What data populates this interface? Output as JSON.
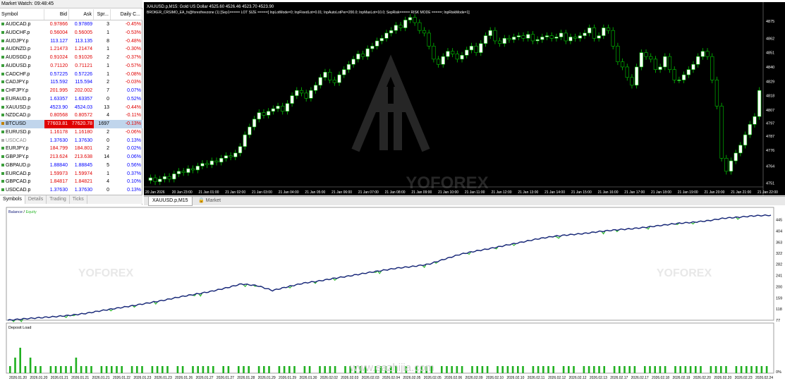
{
  "market_watch": {
    "title": "Market Watch: 09:48:45",
    "columns": [
      "Symbol",
      "Bid",
      "Ask",
      "Spr...",
      "Daily C..."
    ],
    "rows": [
      {
        "symbol": "AUDCAD.p",
        "bid": "0.97866",
        "ask": "0.97869",
        "spread": "3",
        "change": "-0.45%",
        "color": "#e00000",
        "bidcolor": "#e00000",
        "askcolor": "#0000ff"
      },
      {
        "symbol": "AUDCHF.p",
        "bid": "0.56004",
        "ask": "0.56005",
        "spread": "1",
        "change": "-0.53%",
        "color": "#e00000",
        "bidcolor": "#e00000",
        "askcolor": "#e00000"
      },
      {
        "symbol": "AUDJPY.p",
        "bid": "113.127",
        "ask": "113.135",
        "spread": "8",
        "change": "-0.48%",
        "color": "#e00000",
        "bidcolor": "#0000ff",
        "askcolor": "#0000ff"
      },
      {
        "symbol": "AUDNZD.p",
        "bid": "1.21473",
        "ask": "1.21474",
        "spread": "1",
        "change": "-0.30%",
        "color": "#e00000",
        "bidcolor": "#e00000",
        "askcolor": "#e00000"
      },
      {
        "symbol": "AUDSGD.p",
        "bid": "0.91024",
        "ask": "0.91026",
        "spread": "2",
        "change": "-0.37%",
        "color": "#e00000",
        "bidcolor": "#e00000",
        "askcolor": "#e00000"
      },
      {
        "symbol": "AUDUSD.p",
        "bid": "0.71120",
        "ask": "0.71121",
        "spread": "1",
        "change": "-0.57%",
        "color": "#e00000",
        "bidcolor": "#e00000",
        "askcolor": "#e00000"
      },
      {
        "symbol": "CADCHF.p",
        "bid": "0.57225",
        "ask": "0.57226",
        "spread": "1",
        "change": "-0.08%",
        "color": "#e00000",
        "bidcolor": "#0000ff",
        "askcolor": "#0000ff"
      },
      {
        "symbol": "CADJPY.p",
        "bid": "115.592",
        "ask": "115.594",
        "spread": "2",
        "change": "-0.03%",
        "color": "#e00000",
        "bidcolor": "#0000ff",
        "askcolor": "#0000ff"
      },
      {
        "symbol": "CHFJPY.p",
        "bid": "201.995",
        "ask": "202.002",
        "spread": "7",
        "change": "0.07%",
        "color": "#0000ff",
        "bidcolor": "#e00000",
        "askcolor": "#e00000"
      },
      {
        "symbol": "EURAUD.p",
        "bid": "1.63357",
        "ask": "1.63357",
        "spread": "0",
        "change": "0.52%",
        "color": "#0000ff",
        "bidcolor": "#0000ff",
        "askcolor": "#0000ff"
      },
      {
        "symbol": "XAUUSD.p",
        "bid": "4523.90",
        "ask": "4524.03",
        "spread": "13",
        "change": "-0.44%",
        "color": "#e00000",
        "bidcolor": "#0000ff",
        "askcolor": "#0000ff"
      },
      {
        "symbol": "NZDCAD.p",
        "bid": "0.80568",
        "ask": "0.80572",
        "spread": "4",
        "change": "-0.11%",
        "color": "#e00000",
        "bidcolor": "#e00000",
        "askcolor": "#e00000"
      },
      {
        "symbol": "BTCUSD",
        "bid": "77603.81",
        "ask": "77620.78",
        "spread": "1697",
        "change": "-0.13%",
        "color": "#e00000",
        "bidcolor": "#e00000",
        "askcolor": "#e00000",
        "selected": true
      },
      {
        "symbol": "EURUSD.p",
        "bid": "1.16178",
        "ask": "1.16180",
        "spread": "2",
        "change": "-0.06%",
        "color": "#e00000",
        "bidcolor": "#e00000",
        "askcolor": "#e00000"
      },
      {
        "symbol": "USDCAD",
        "bid": "1.37630",
        "ask": "1.37630",
        "spread": "0",
        "change": "0.13%",
        "color": "#0000ff",
        "bidcolor": "#0000ff",
        "askcolor": "#0000ff",
        "grey": true
      },
      {
        "symbol": "EURJPY.p",
        "bid": "184.799",
        "ask": "184.801",
        "spread": "2",
        "change": "0.02%",
        "color": "#0000ff",
        "bidcolor": "#e00000",
        "askcolor": "#e00000"
      },
      {
        "symbol": "GBPJPY.p",
        "bid": "213.624",
        "ask": "213.638",
        "spread": "14",
        "change": "0.06%",
        "color": "#0000ff",
        "bidcolor": "#e00000",
        "askcolor": "#e00000"
      },
      {
        "symbol": "GBPAUD.p",
        "bid": "1.88840",
        "ask": "1.88845",
        "spread": "5",
        "change": "0.56%",
        "color": "#0000ff",
        "bidcolor": "#0000ff",
        "askcolor": "#0000ff"
      },
      {
        "symbol": "EURCAD.p",
        "bid": "1.59973",
        "ask": "1.59974",
        "spread": "1",
        "change": "0.37%",
        "color": "#0000ff",
        "bidcolor": "#e00000",
        "askcolor": "#e00000"
      },
      {
        "symbol": "GBPCAD.p",
        "bid": "1.84817",
        "ask": "1.84821",
        "spread": "4",
        "change": "0.10%",
        "color": "#0000ff",
        "bidcolor": "#e00000",
        "askcolor": "#e00000"
      },
      {
        "symbol": "USDCAD.p",
        "bid": "1.37630",
        "ask": "1.37630",
        "spread": "0",
        "change": "0.13%",
        "color": "#0000ff",
        "bidcolor": "#0000ff",
        "askcolor": "#0000ff"
      }
    ],
    "tabs": [
      "Symbols",
      "Details",
      "Trading",
      "Ticks"
    ]
  },
  "price_chart": {
    "header": "XAUUSD.p,M15:  Gold US Dollar  4525.60 4526.46 4523.70 4523.90",
    "ea_line": "BROKER_CRSIMO_EA_fx@forexfreezone (1) [Sep1===== LOT SIZE =====] InpLotMode=0; InpFixedLot=0.01; InpAutoLotPer=200.0; InpMaxLot=10.0; SepRisk===== RISK MODE =====; InpRiskMode=1]",
    "y_labels": [
      "4875",
      "4862",
      "4851",
      "4840",
      "4829",
      "4818",
      "4807",
      "4797",
      "4787",
      "4776",
      "4764",
      "4751"
    ],
    "x_labels": [
      "20 Jan 2026",
      "20 Jan 23:00",
      "21 Jan 01:00",
      "21 Jan 02:00",
      "21 Jan 03:00",
      "21 Jan 04:00",
      "21 Jan 05:00",
      "21 Jan 06:00",
      "21 Jan 07:00",
      "21 Jan 08:00",
      "21 Jan 09:00",
      "21 Jan 10:00",
      "21 Jan 11:00",
      "21 Jan 12:00",
      "21 Jan 13:00",
      "21 Jan 14:00",
      "21 Jan 15:00",
      "21 Jan 16:00",
      "21 Jan 17:00",
      "21 Jan 18:00",
      "21 Jan 19:00",
      "21 Jan 20:00",
      "21 Jan 21:00",
      "21 Jan 22:00"
    ],
    "closes": [
      4755,
      4752,
      4754,
      4756,
      4754,
      4758,
      4760,
      4759,
      4762,
      4761,
      4764,
      4766,
      4765,
      4768,
      4767,
      4770,
      4772,
      4771,
      4774,
      4779,
      4788,
      4794,
      4800,
      4805,
      4803,
      4806,
      4808,
      4810,
      4806,
      4812,
      4818,
      4822,
      4820,
      4816,
      4822,
      4826,
      4832,
      4836,
      4830,
      4828,
      4834,
      4838,
      4842,
      4846,
      4850,
      4848,
      4854,
      4856,
      4860,
      4862,
      4866,
      4868,
      4872,
      4870,
      4876,
      4878,
      4874,
      4868,
      4866,
      4856,
      4846,
      4842,
      4848,
      4852,
      4850,
      4846,
      4849,
      4853,
      4856,
      4851,
      4858,
      4864,
      4868,
      4860,
      4858,
      4862,
      4861,
      4863,
      4864,
      4862,
      4865,
      4860,
      4861,
      4863,
      4864,
      4862,
      4863,
      4866,
      4860,
      4863,
      4862,
      4864,
      4866,
      4870,
      4862,
      4864,
      4870,
      4868,
      4856,
      4844,
      4840,
      4832,
      4826,
      4840,
      4851,
      4848,
      4846,
      4838,
      4840,
      4848,
      4838,
      4830,
      4830,
      4834,
      4838,
      4842,
      4848,
      4852,
      4848,
      4830,
      4810,
      4770,
      4760,
      4768,
      4774,
      4780,
      4788,
      4796,
      4802,
      4822
    ],
    "colors": {
      "bg": "#000000",
      "candle": "#ffffff",
      "bear": "#000000",
      "wick": "#00c800",
      "grid": "#3a3a3a",
      "text": "#ffffff"
    },
    "watermark": "YOFOREX",
    "tabs": [
      "XAUUSD.p,M15",
      "Market"
    ]
  },
  "chart_data": [
    {
      "type": "line",
      "title": "",
      "series": [
        {
          "name": "Balance",
          "color": "#1a237e"
        },
        {
          "name": "Equity",
          "color": "#2eb82e"
        }
      ],
      "x": [
        "2026.01.20",
        "2026.01.20",
        "2026.01.21",
        "2026.01.21",
        "2026.01.21",
        "2026.01.22",
        "2026.01.23",
        "2026.01.23",
        "2026.01.26",
        "2026.01.27",
        "2026.01.27",
        "2026.01.28",
        "2026.01.29",
        "2026.01.29",
        "2026.01.30",
        "2026.02.02",
        "2026.02.03",
        "2026.02.03",
        "2026.02.04",
        "2026.02.05",
        "2026.02.05",
        "2026.02.06",
        "2026.02.09",
        "2026.02.10",
        "2026.02.10",
        "2026.02.11",
        "2026.02.12",
        "2026.02.12",
        "2026.02.13",
        "2026.02.17",
        "2026.02.17",
        "2026.02.18",
        "2026.02.19",
        "2026.02.20",
        "2026.02.20",
        "2026.02.23",
        "2026.02.24"
      ],
      "y_ticks": [
        "77",
        "118",
        "159",
        "200",
        "241",
        "282",
        "322",
        "363",
        "404",
        "445"
      ],
      "balance": [
        77,
        82,
        86,
        90,
        95,
        102,
        112,
        121,
        130,
        140,
        150,
        162,
        172,
        182,
        195,
        210,
        204,
        186,
        200,
        213,
        221,
        231,
        240,
        250,
        259,
        268,
        274,
        282,
        300,
        318,
        330,
        340,
        352,
        363,
        375,
        384,
        390,
        395,
        402,
        408,
        412,
        418,
        425,
        432,
        436,
        442,
        451,
        455,
        460,
        462
      ],
      "ylim": [
        77,
        470
      ]
    },
    {
      "type": "bar",
      "title": "Deposit Load",
      "y_ticks": [
        "0%"
      ],
      "values": [
        1,
        2,
        3,
        1,
        2,
        1,
        1,
        0,
        1,
        1,
        1,
        1,
        1,
        2,
        1,
        1,
        1,
        0,
        1,
        1,
        1,
        1,
        1,
        0,
        1,
        1,
        1,
        0,
        1,
        1,
        1,
        1,
        0,
        1,
        1,
        0,
        1,
        1,
        1,
        1,
        1,
        0,
        1,
        1,
        0,
        1,
        1,
        1,
        0,
        1,
        1,
        1,
        0,
        1,
        1,
        1,
        1,
        0,
        1,
        1,
        0,
        1,
        1,
        1,
        1,
        0,
        1,
        1,
        1,
        1,
        1,
        0,
        1,
        1,
        1,
        1,
        1,
        0,
        1,
        0,
        1,
        1,
        1,
        1,
        0,
        1,
        1,
        1,
        1,
        1,
        0,
        1,
        1,
        1,
        1,
        0,
        1,
        1,
        1,
        1,
        1,
        1,
        0,
        1,
        1,
        1,
        1,
        1,
        0,
        1,
        1,
        1,
        0,
        1,
        1,
        1,
        1,
        1,
        0,
        1,
        1,
        1,
        1,
        1,
        0,
        1,
        1,
        1,
        1,
        1,
        0,
        1,
        1,
        1,
        1,
        1,
        1,
        0,
        1,
        1,
        1,
        1,
        0,
        1,
        1,
        1,
        1,
        1,
        1,
        1
      ]
    }
  ],
  "tester": {
    "legend_balance": "Balance",
    "legend_sep": " / ",
    "legend_equity": "Equity",
    "deposit_label": "Deposit Load",
    "watermark_text": "www.eazhijia.com",
    "logo": "YOFOREX"
  }
}
